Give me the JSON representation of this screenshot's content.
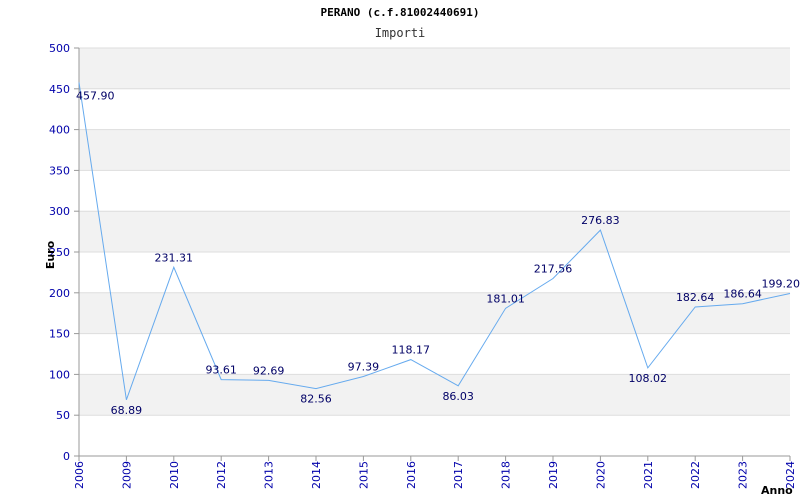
{
  "chart_data": {
    "type": "line",
    "title": "PERANO (c.f.81002440691)",
    "subtitle": "Importi",
    "xlabel": "Anno",
    "ylabel": "Euro",
    "categories": [
      "2006",
      "2009",
      "2010",
      "2012",
      "2013",
      "2014",
      "2015",
      "2016",
      "2017",
      "2018",
      "2019",
      "2020",
      "2021",
      "2022",
      "2023",
      "2024"
    ],
    "series": [
      {
        "values": [
          457.9,
          68.89,
          231.31,
          93.61,
          92.69,
          82.56,
          97.39,
          118.17,
          86.03,
          181.01,
          217.56,
          276.83,
          108.02,
          182.64,
          186.64,
          199.2
        ],
        "labels": [
          "457.90",
          "68.89",
          "231.31",
          "93.61",
          "92.69",
          "82.56",
          "97.39",
          "118.17",
          "86.03",
          "181.01",
          "217.56",
          "276.83",
          "108.02",
          "182.64",
          "186.64",
          "199.20"
        ]
      }
    ],
    "ylim": [
      0,
      500
    ],
    "yticks": [
      "0",
      "50",
      "100",
      "150",
      "200",
      "250",
      "300",
      "350",
      "400",
      "450",
      "500"
    ],
    "grid": true,
    "colors": {
      "line": "#66aaee",
      "band": "#f2f2f2",
      "gridline": "#dddddd",
      "tick_text": "#0000aa",
      "label_text": "#000066"
    }
  }
}
